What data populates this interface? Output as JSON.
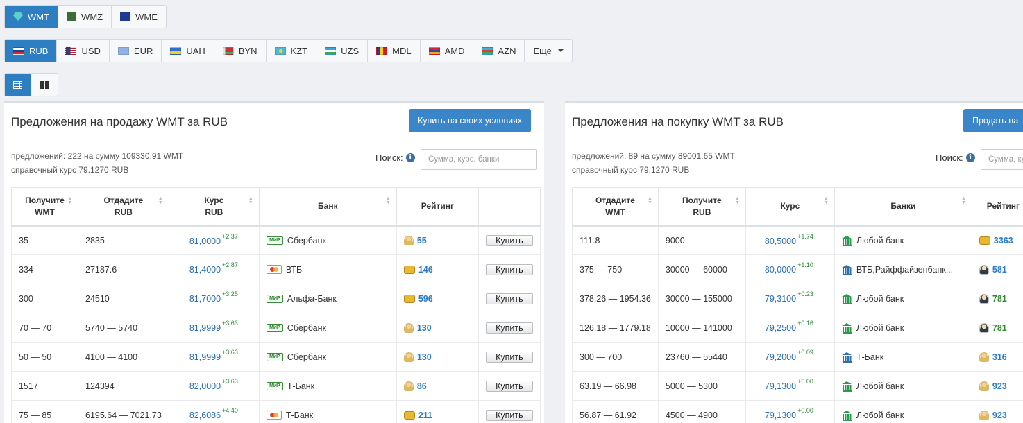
{
  "wm_tabs": [
    {
      "label": "WMT",
      "icon": "diamond-icon",
      "active": true
    },
    {
      "label": "WMZ",
      "icon": "wmz-icon",
      "active": false
    },
    {
      "label": "WME",
      "icon": "eu-flag-icon",
      "active": false
    }
  ],
  "currency_tabs": [
    {
      "label": "RUB",
      "icon": "flag-ru-icon",
      "active": true
    },
    {
      "label": "USD",
      "icon": "flag-us-icon"
    },
    {
      "label": "EUR",
      "icon": "flag-eu-icon"
    },
    {
      "label": "UAH",
      "icon": "flag-ua-icon"
    },
    {
      "label": "BYN",
      "icon": "flag-by-icon"
    },
    {
      "label": "KZT",
      "icon": "flag-kz-icon"
    },
    {
      "label": "UZS",
      "icon": "flag-uz-icon"
    },
    {
      "label": "MDL",
      "icon": "flag-md-icon"
    },
    {
      "label": "AMD",
      "icon": "flag-am-icon"
    },
    {
      "label": "AZN",
      "icon": "flag-az-icon"
    },
    {
      "label": "Еще",
      "icon": "chevron-down-icon"
    }
  ],
  "view_tabs": [
    {
      "icon": "table-view-icon",
      "active": true
    },
    {
      "icon": "grid-view-icon",
      "active": false
    }
  ],
  "sell": {
    "title": "Предложения на продажу WMT за RUB",
    "action_label": "Купить на своих условиях",
    "summary_line1": "предложений: 222 на сумму 109330.91 WMT",
    "summary_line2": "справочный курс 79.1270 RUB",
    "search_label": "Поиск:",
    "search_placeholder": "Сумма, курс, банки",
    "headers": {
      "receive": "Получите",
      "receive_unit": "WMT",
      "give": "Отдадите",
      "give_unit": "RUB",
      "rate": "Курс",
      "rate_unit": "RUB",
      "bank": "Банк",
      "rating": "Рейтинг"
    },
    "row_button_label": "Купить",
    "rows": [
      {
        "receive": "35",
        "give": "2835",
        "rate": "81,0000",
        "delta": "+2.37",
        "bank": "Сбербанк",
        "bank_icon": "mir-card-icon",
        "rating": "55",
        "rating_icon": "person-icon"
      },
      {
        "receive": "334",
        "give": "27187.6",
        "rate": "81,4000",
        "delta": "+2.87",
        "bank": "ВТБ",
        "bank_icon": "mastercard-icon",
        "rating": "146",
        "rating_icon": "badge-icon"
      },
      {
        "receive": "300",
        "give": "24510",
        "rate": "81,7000",
        "delta": "+3.25",
        "bank": "Альфа-Банк",
        "bank_icon": "mir-card-icon",
        "rating": "596",
        "rating_icon": "badge-icon"
      },
      {
        "receive": "70 — 70",
        "give": "5740 — 5740",
        "rate": "81,9999",
        "delta": "+3.63",
        "bank": "Сбербанк",
        "bank_icon": "mir-card-icon",
        "rating": "130",
        "rating_icon": "person-icon"
      },
      {
        "receive": "50 — 50",
        "give": "4100 — 4100",
        "rate": "81,9999",
        "delta": "+3.63",
        "bank": "Сбербанк",
        "bank_icon": "mir-card-icon",
        "rating": "130",
        "rating_icon": "person-icon"
      },
      {
        "receive": "1517",
        "give": "124394",
        "rate": "82,0000",
        "delta": "+3.63",
        "bank": "Т-Банк",
        "bank_icon": "mir-card-icon",
        "rating": "86",
        "rating_icon": "person-icon"
      },
      {
        "receive": "75 — 85",
        "give": "6195.64 — 7021.73",
        "rate": "82,6086",
        "delta": "+4.40",
        "bank": "Т-Банк",
        "bank_icon": "mastercard-icon",
        "rating": "211",
        "rating_icon": "badge-icon"
      }
    ]
  },
  "buy": {
    "title": "Предложения на покупку WMT за RUB",
    "action_label": "Продать на",
    "summary_line1": "предложений: 89 на сумму 89001.65 WMT",
    "summary_line2": "справочный курс 79.1270 RUB",
    "search_label": "Поиск:",
    "search_placeholder": "Сумма, курс",
    "headers": {
      "give": "Отдадите",
      "give_unit": "WMT",
      "receive": "Получите",
      "receive_unit": "RUB",
      "rate": "Курс",
      "bank": "Банки",
      "rating": "Рейтинг"
    },
    "rows": [
      {
        "give": "111.8",
        "receive": "9000",
        "rate": "80,5000",
        "delta": "+1.74",
        "bank": "Любой банк",
        "bank_icon": "bank-green-icon",
        "rating": "3363",
        "rating_icon": "badge-icon",
        "rating_color": "blue"
      },
      {
        "give": "375 — 750",
        "receive": "30000 — 60000",
        "rate": "80,0000",
        "delta": "+1.10",
        "bank": "ВТБ,Райффайзенбанк...",
        "bank_icon": "bank-blue-icon",
        "rating": "581",
        "rating_icon": "dark-person-icon",
        "rating_color": "blue"
      },
      {
        "give": "378.26 — 1954.36",
        "receive": "30000 — 155000",
        "rate": "79,3100",
        "delta": "+0.23",
        "bank": "Любой банк",
        "bank_icon": "bank-green-icon",
        "rating": "781",
        "rating_icon": "dark-person-icon",
        "rating_color": "green"
      },
      {
        "give": "126.18 — 1779.18",
        "receive": "10000 — 141000",
        "rate": "79,2500",
        "delta": "+0.16",
        "bank": "Любой банк",
        "bank_icon": "bank-green-icon",
        "rating": "781",
        "rating_icon": "dark-person-icon",
        "rating_color": "green"
      },
      {
        "give": "300 — 700",
        "receive": "23760 — 55440",
        "rate": "79,2000",
        "delta": "+0.09",
        "bank": "Т-Банк",
        "bank_icon": "bank-blue-icon",
        "rating": "316",
        "rating_icon": "person-icon",
        "rating_color": "blue"
      },
      {
        "give": "63.19 — 66.98",
        "receive": "5000 — 5300",
        "rate": "79,1300",
        "delta": "+0.00",
        "bank": "Любой банк",
        "bank_icon": "bank-green-icon",
        "rating": "923",
        "rating_icon": "person-icon",
        "rating_color": "blue"
      },
      {
        "give": "56.87 — 61.92",
        "receive": "4500 — 4900",
        "rate": "79,1300",
        "delta": "+0.00",
        "bank": "Любой банк",
        "bank_icon": "bank-green-icon",
        "rating": "923",
        "rating_icon": "person-icon",
        "rating_color": "blue"
      }
    ]
  },
  "colors": {
    "accent": "#2d7fc1",
    "rate_text": "#2a6eb2",
    "delta_text": "#2b8a3e"
  }
}
